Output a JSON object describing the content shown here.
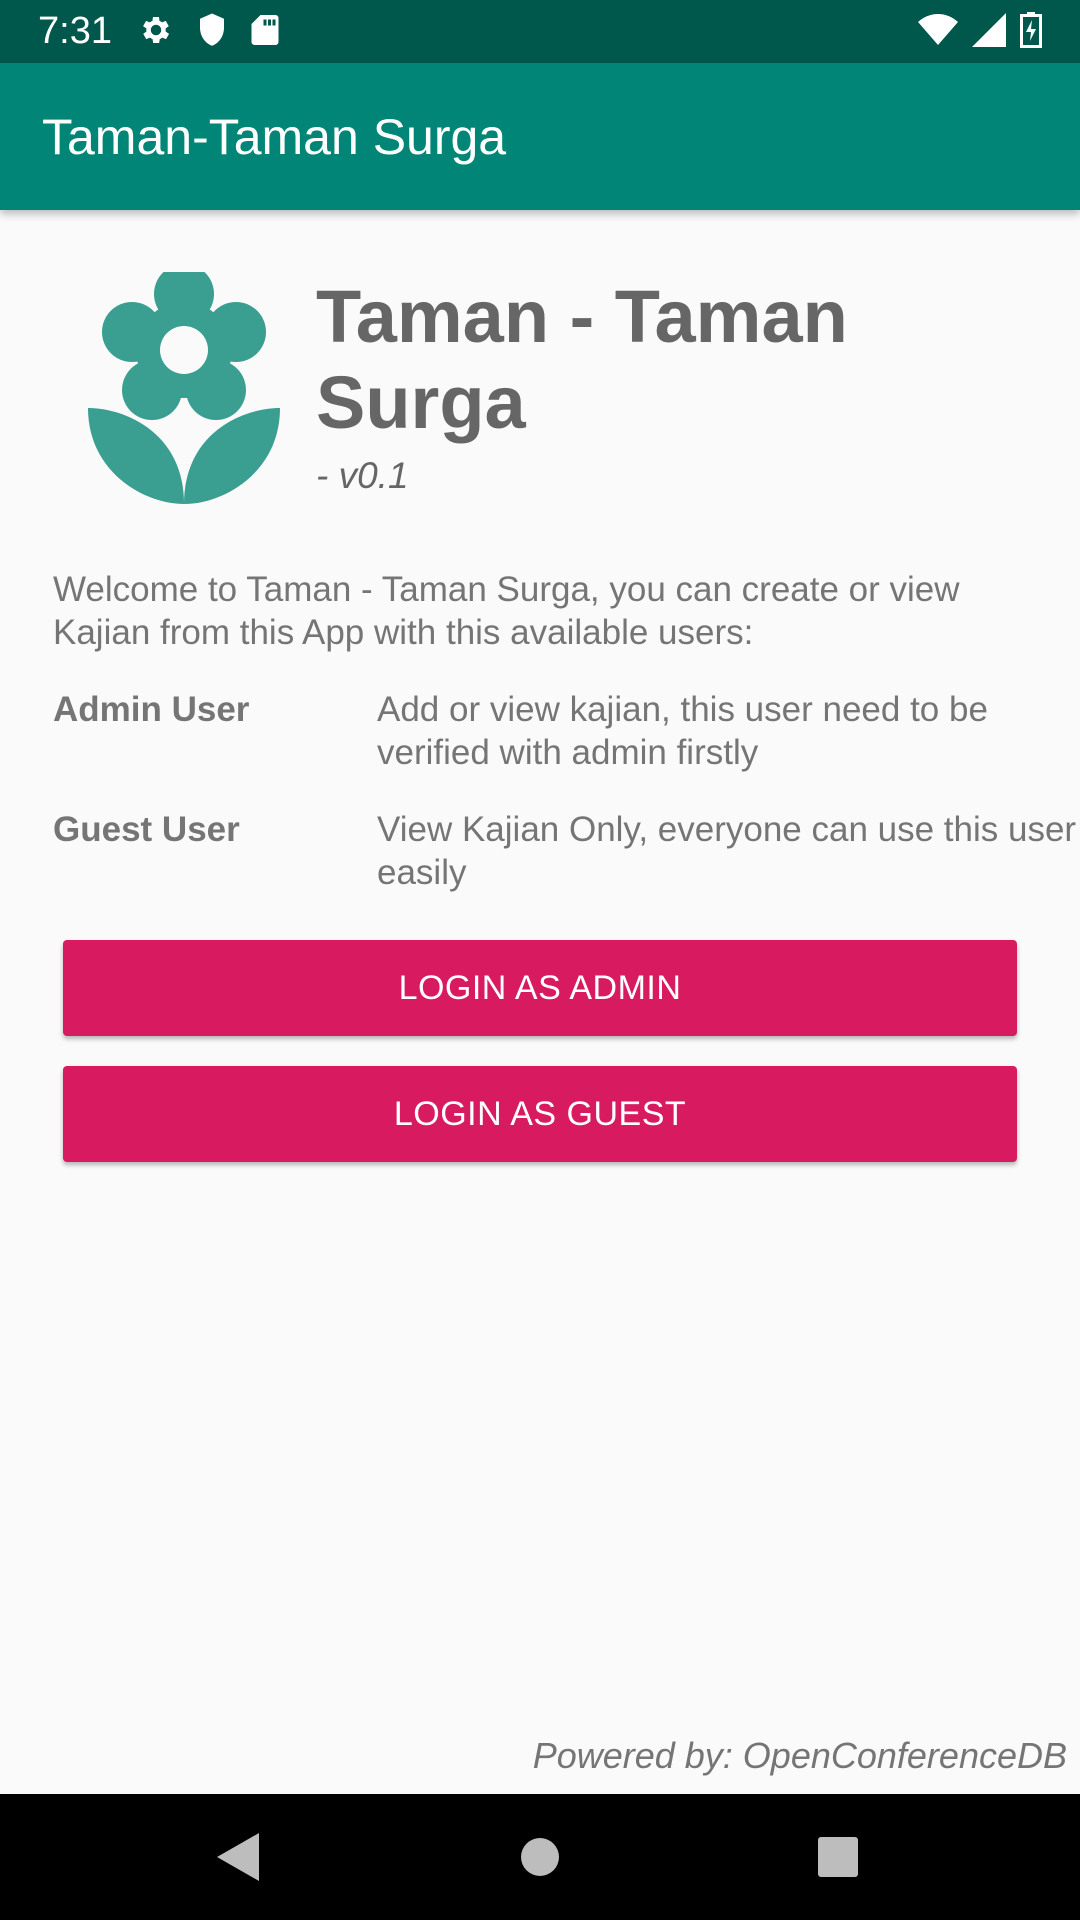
{
  "status_bar": {
    "time": "7:31",
    "left_icons": [
      "gear-icon",
      "shield-icon",
      "sd-card-icon"
    ],
    "right_icons": [
      "wifi-icon",
      "signal-icon",
      "battery-charging-icon"
    ]
  },
  "app_bar": {
    "title": "Taman-Taman Surga"
  },
  "header": {
    "logo_icon": "flower-icon",
    "title": "Taman - Taman Surga",
    "version": "- v0.1"
  },
  "welcome_text": "Welcome to Taman - Taman Surga, you can create or view Kajian from this App with this available users:",
  "users": [
    {
      "label": "Admin User",
      "description": "Add or view kajian, this user need to be verified with admin firstly"
    },
    {
      "label": "Guest User",
      "description": "View Kajian Only, everyone can use this user easily"
    }
  ],
  "buttons": {
    "login_admin": "LOGIN AS ADMIN",
    "login_guest": "LOGIN AS GUEST"
  },
  "footer": {
    "powered_by": "Powered by: OpenConferenceDB"
  },
  "nav_bar": {
    "buttons": [
      "back-icon",
      "home-icon",
      "recents-icon"
    ]
  },
  "colors": {
    "status_bar": "#00574b",
    "app_bar": "#008577",
    "accent": "#d81b60",
    "logo": "#3a9e90"
  }
}
